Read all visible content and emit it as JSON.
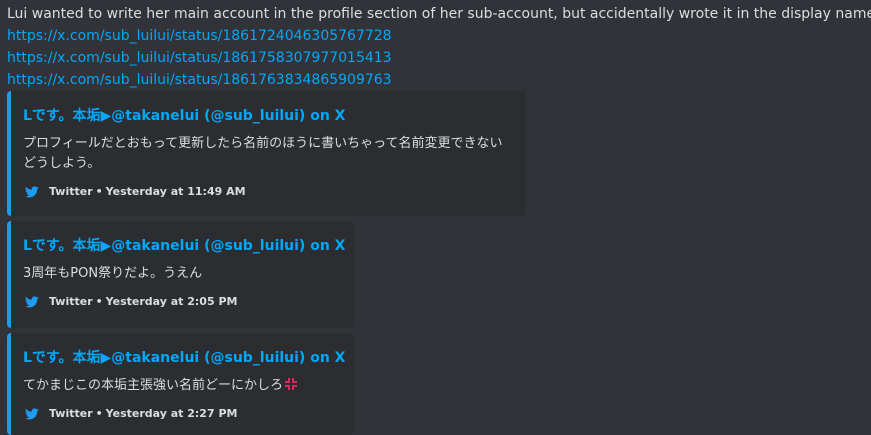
{
  "message": {
    "text": "Lui wanted to write her main account in the profile section of her sub-account, but accidentally wrote it in the display name",
    "emoji": "custom-emoji",
    "links": [
      "https://x.com/sub_luilui/status/1861724046305767728",
      "https://x.com/sub_luilui/status/1861758307977015413",
      "https://x.com/sub_luilui/status/1861763834865909763"
    ]
  },
  "embeds": [
    {
      "author": "Lです。本垢▶@takanelui (@sub_luilui) on X",
      "description": "プロフィールだとおもって更新したら名前のほうに書いちゃって名前変更できないどうしよう。",
      "provider": "Twitter",
      "separator": "•",
      "timestamp": "Yesterday at 11:49 AM"
    },
    {
      "author": "Lです。本垢▶@takanelui (@sub_luilui) on X",
      "description": "3周年もPON祭りだよ。うえん",
      "provider": "Twitter",
      "separator": "•",
      "timestamp": "Yesterday at 2:05 PM"
    },
    {
      "author": "Lです。本垢▶@takanelui (@sub_luilui) on X",
      "description": "てかまじこの本垢主張強い名前どーにかしろ",
      "description_emoji": "anger-symbol",
      "provider": "Twitter",
      "separator": "•",
      "timestamp": "Yesterday at 2:27 PM"
    }
  ],
  "colors": {
    "background": "#313338",
    "embed_background": "#2b2d31",
    "embed_border": "#1d9bf0",
    "link": "#00a8fc",
    "text": "#dbdee1"
  }
}
